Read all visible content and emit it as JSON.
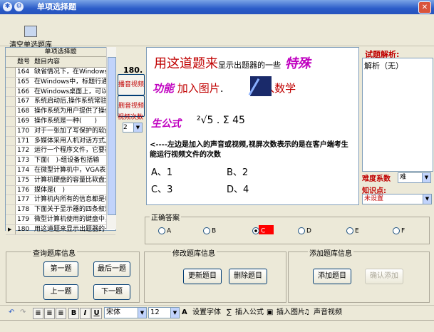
{
  "window": {
    "title": "单项选择题"
  },
  "toolbar": {
    "clear_label": "清空单选题库"
  },
  "grid": {
    "caption": "单项选择题",
    "col_id": "题号",
    "col_content": "题目内容",
    "rows": [
      {
        "id": "164",
        "content": "缺省情况下，在Windows"
      },
      {
        "id": "165",
        "content": "在Windows中，标题行通"
      },
      {
        "id": "166",
        "content": "在Windows桌面上，可以"
      },
      {
        "id": "167",
        "content": "系统启动后,操作系统常驻"
      },
      {
        "id": "168",
        "content": "操作系统为用户提供了操作"
      },
      {
        "id": "169",
        "content": "操作系统是一种(　　)"
      },
      {
        "id": "170",
        "content": "对于一张加了写保护的软盘"
      },
      {
        "id": "171",
        "content": "多媒体采用人机对话方式,"
      },
      {
        "id": "172",
        "content": "运行一个程序文件，它要被"
      },
      {
        "id": "173",
        "content": "下面(　)-组设备包括输"
      },
      {
        "id": "174",
        "content": "在微型计算机中，VGA表示"
      },
      {
        "id": "175",
        "content": "计算机硬盘的容量比软盘大"
      },
      {
        "id": "176",
        "content": "媒体是(　)"
      },
      {
        "id": "177",
        "content": "计算机内所有的信息都是以"
      },
      {
        "id": "178",
        "content": "下面关于显示器的四条叙述"
      },
      {
        "id": "179",
        "content": "微型计算机使用的键盘中，"
      },
      {
        "id": "180",
        "content": "用这道题来显示出题器的一"
      }
    ]
  },
  "media": {
    "count": "180.",
    "play_label": "播音视频",
    "delete_label": "删音视频",
    "times_label": "视频次数",
    "times_value": "2"
  },
  "preview": {
    "line1_big": "用这道题来",
    "line1_small": "显示出题器的一些",
    "line1_fancy": "特殊",
    "line2_fancy": "功能",
    "line2_a": "加入图片",
    "line2_b": ".",
    "line2_c": "加入数学",
    "line3": "生公式",
    "formula": "²√5 . Σ 45",
    "question": "<----左边是加入的声音或视频,视屏次数表示的是在客户端考生能运行视频文件的次数",
    "optA": "A、1",
    "optB": "B、2",
    "optC": "C、3",
    "optD": "D、4"
  },
  "analysis": {
    "label": "试题解析:",
    "text": "解析（无）"
  },
  "difficulty": {
    "label": "难度系数",
    "value": "难"
  },
  "knowledge": {
    "label": "知识点:",
    "value": "未设置"
  },
  "answer": {
    "title": "正确答案",
    "options": [
      "A",
      "B",
      "C",
      "D",
      "E",
      "F"
    ],
    "selected": "C"
  },
  "query": {
    "title": "查询题库信息",
    "first": "第一题",
    "last": "最后一题",
    "prev": "上一题",
    "next": "下一题"
  },
  "modify": {
    "title": "修改题库信息",
    "update": "更新题目",
    "delete": "删除题目"
  },
  "add": {
    "title": "添加题库信息",
    "add": "添加题目",
    "confirm": "确认添加"
  },
  "format": {
    "font_name": "宋体",
    "font_size": "12",
    "set_font": "设置字体",
    "insert_formula": "插入公式",
    "insert_image": "插入图片",
    "audio_video": "声音视频"
  },
  "colors": {
    "accent": "#c00000",
    "titlebar": "#2b5cc8",
    "answer_mark": "#ff0000"
  }
}
